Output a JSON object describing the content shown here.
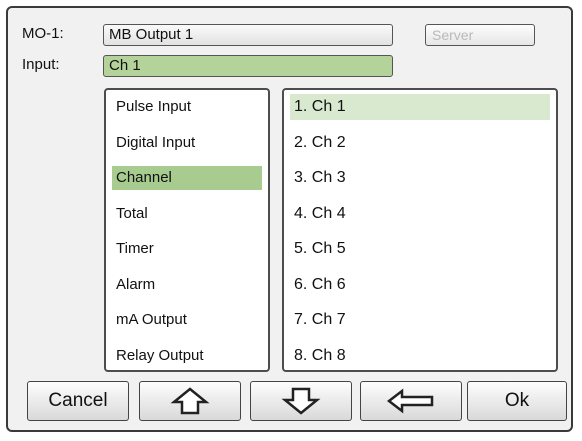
{
  "header": {
    "mo_label": "MO-1:",
    "mo_value": "MB Output 1",
    "server_label": "Server",
    "input_label": "Input:",
    "input_value": "Ch 1"
  },
  "source_types": [
    {
      "label": "Pulse Input",
      "selected": false
    },
    {
      "label": "Digital Input",
      "selected": false
    },
    {
      "label": "Channel",
      "selected": true
    },
    {
      "label": "Total",
      "selected": false
    },
    {
      "label": "Timer",
      "selected": false
    },
    {
      "label": "Alarm",
      "selected": false
    },
    {
      "label": "mA Output",
      "selected": false
    },
    {
      "label": "Relay Output",
      "selected": false
    }
  ],
  "channels": [
    {
      "label": "1. Ch 1",
      "selected": true
    },
    {
      "label": "2. Ch 2",
      "selected": false
    },
    {
      "label": "3. Ch 3",
      "selected": false
    },
    {
      "label": "4. Ch 4",
      "selected": false
    },
    {
      "label": "5. Ch 5",
      "selected": false
    },
    {
      "label": "6. Ch 6",
      "selected": false
    },
    {
      "label": "7. Ch 7",
      "selected": false
    },
    {
      "label": "8. Ch 8",
      "selected": false
    }
  ],
  "buttons": {
    "cancel": "Cancel",
    "up": "up-arrow-icon",
    "down": "down-arrow-icon",
    "back": "left-arrow-icon",
    "ok": "Ok"
  },
  "colors": {
    "selection": "#a8cc8f",
    "channel_selection": "#d9e9cf",
    "input_field": "#b3d39a"
  }
}
